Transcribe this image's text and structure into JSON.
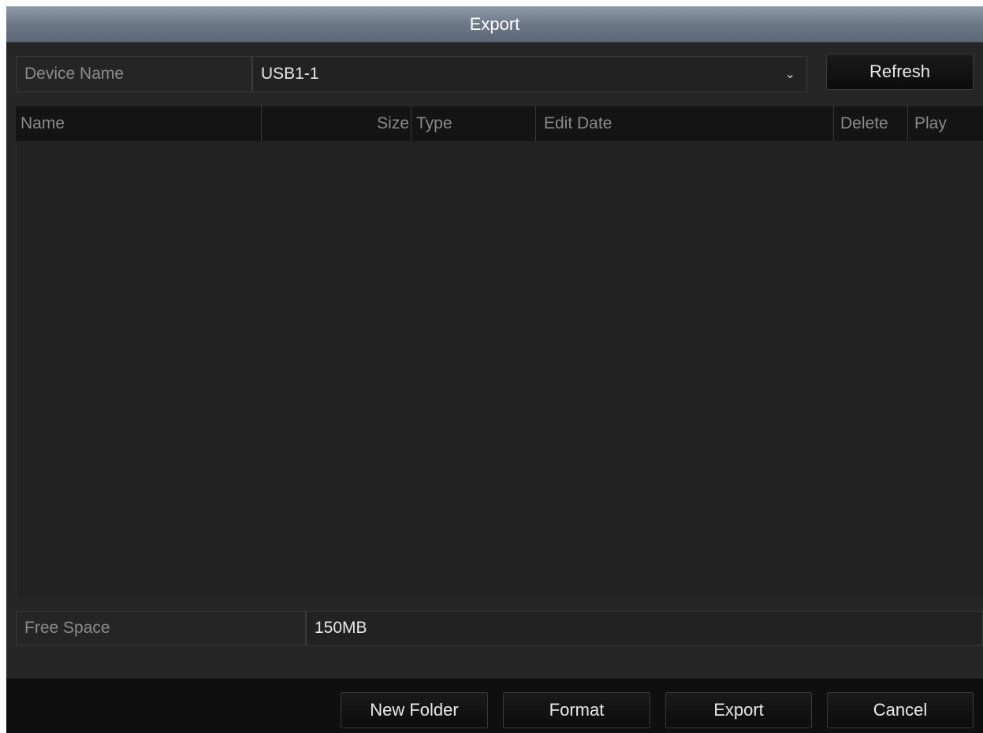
{
  "window": {
    "title": "Export"
  },
  "device": {
    "label": "Device Name",
    "value": "USB1-1",
    "refresh_label": "Refresh"
  },
  "table": {
    "columns": [
      {
        "key": "name",
        "label": "Name"
      },
      {
        "key": "size",
        "label": "Size"
      },
      {
        "key": "type",
        "label": "Type"
      },
      {
        "key": "edit_date",
        "label": "Edit Date"
      },
      {
        "key": "delete",
        "label": "Delete"
      },
      {
        "key": "play",
        "label": "Play"
      }
    ],
    "rows": []
  },
  "free_space": {
    "label": "Free Space",
    "value": "150MB"
  },
  "footer": {
    "new_folder_label": "New Folder",
    "format_label": "Format",
    "export_label": "Export",
    "cancel_label": "Cancel"
  },
  "icons": {
    "combo_arrow": "chevron-down-icon"
  },
  "colors": {
    "background": "#262626",
    "titlebar": "#6d7888",
    "button": "#111111",
    "text": "#eaeaea",
    "label_text": "#8c8c8c"
  }
}
